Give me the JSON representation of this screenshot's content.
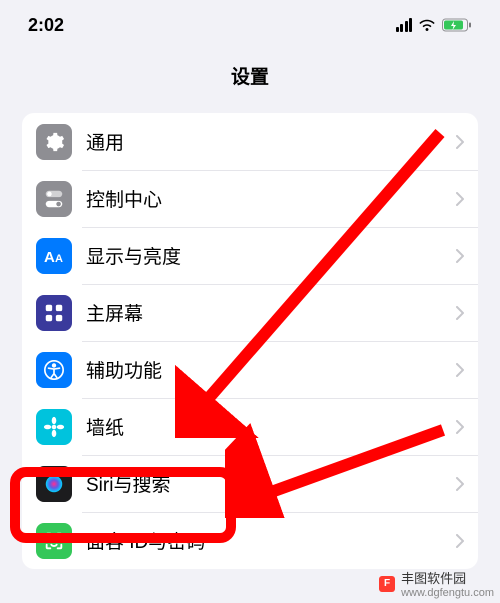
{
  "status": {
    "time": "2:02"
  },
  "title": "设置",
  "rows": {
    "general": {
      "label": "通用"
    },
    "control_center": {
      "label": "控制中心"
    },
    "display": {
      "label": "显示与亮度"
    },
    "home_screen": {
      "label": "主屏幕"
    },
    "accessibility": {
      "label": "辅助功能"
    },
    "wallpaper": {
      "label": "墙纸"
    },
    "siri": {
      "label": "Siri与搜索"
    },
    "faceid": {
      "label": "面容 ID与密码"
    }
  },
  "watermark": {
    "text": "丰图软件园",
    "url": "www.dgfengtu.com"
  }
}
